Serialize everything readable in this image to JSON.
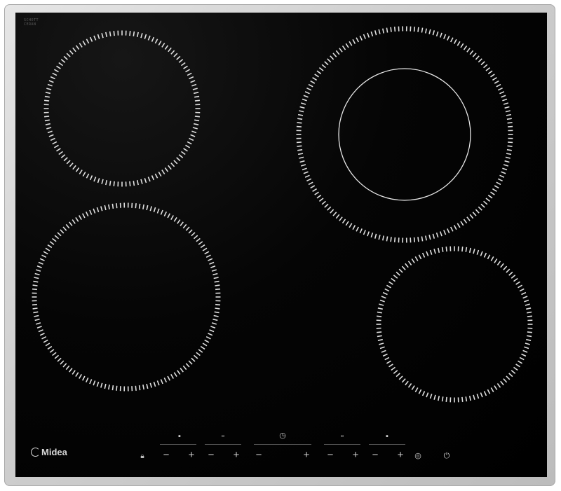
{
  "brand": {
    "name": "Midea"
  },
  "corner_label": [
    "SCHOTT",
    "CERAN"
  ],
  "controls": {
    "lock_icon": "lock-icon",
    "minus": "−",
    "plus": "+",
    "boost_icon": "boost-icon",
    "power_icon": "power-icon",
    "timer_icon": "timer-icon"
  },
  "zones": [
    {
      "name": "rear-left",
      "type": "single"
    },
    {
      "name": "rear-right",
      "type": "dual"
    },
    {
      "name": "front-left",
      "type": "single"
    },
    {
      "name": "front-right",
      "type": "single"
    }
  ],
  "colors": {
    "glass": "#000000",
    "frame": "#c8c8c8",
    "markings": "#e0e0e0"
  }
}
